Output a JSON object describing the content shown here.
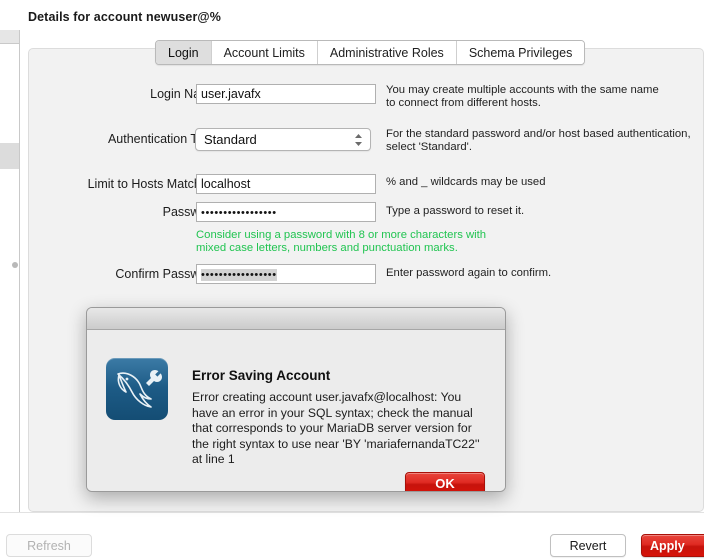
{
  "window": {
    "page_title": "Details for account newuser@%"
  },
  "tabs": [
    {
      "label": "Login",
      "selected": true
    },
    {
      "label": "Account Limits",
      "selected": false
    },
    {
      "label": "Administrative Roles",
      "selected": false
    },
    {
      "label": "Schema Privileges",
      "selected": false
    }
  ],
  "form": {
    "login_name": {
      "label": "Login Name:",
      "value": "user.javafx",
      "hint_line1": "You may create multiple accounts with the same name",
      "hint_line2": "to connect from different hosts."
    },
    "auth_type": {
      "label": "Authentication Type:",
      "value": "Standard",
      "hint_line1": "For the standard password and/or host based authentication,",
      "hint_line2": "select 'Standard'."
    },
    "limit_hosts": {
      "label": "Limit to Hosts Matching:",
      "value": "localhost",
      "hint": "% and _ wildcards may be used"
    },
    "password": {
      "label": "Password:",
      "value": "•••••••••••••••••",
      "hint": "Type a password to reset it.",
      "advice_line1": "Consider using a password with 8 or more characters with",
      "advice_line2": "mixed case letters, numbers and punctuation marks."
    },
    "confirm_password": {
      "label": "Confirm Password:",
      "value": "•••••••••••••••••",
      "hint": "Enter password again to confirm."
    }
  },
  "error_dialog": {
    "title": "Error Saving Account",
    "message": "Error creating account user.javafx@localhost: You have an error in your SQL syntax; check the manual that corresponds to your MariaDB server version for the right syntax to use near 'BY 'mariafernandaTC22'' at line 1",
    "ok_label": "OK"
  },
  "bottom_bar": {
    "refresh_label": "Refresh",
    "revert_label": "Revert",
    "apply_label": "Apply"
  },
  "colors": {
    "accent_red": "#d61309",
    "hint_green": "#21c451",
    "panel_bg": "#f2f2f2",
    "dialog_bg": "#ececec"
  }
}
